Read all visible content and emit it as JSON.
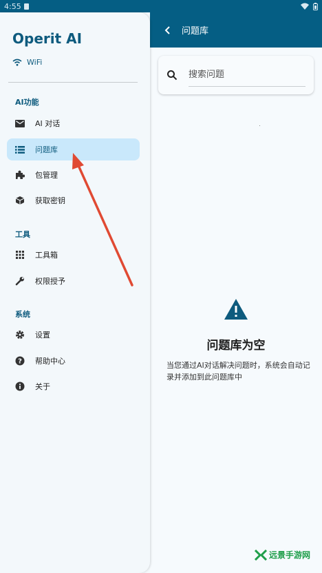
{
  "status_bar": {
    "time": "4:55"
  },
  "app": {
    "name": "Operit AI",
    "network": "WiFi"
  },
  "sections": {
    "ai": "AI功能",
    "tools": "工具",
    "system": "系统"
  },
  "nav": {
    "ai_chat": "AI 对话",
    "question_bank": "问题库",
    "package_manager": "包管理",
    "get_key": "获取密钥",
    "toolbox": "工具箱",
    "permissions": "权限授予",
    "settings": "设置",
    "help": "帮助中心",
    "about": "关于"
  },
  "topbar": {
    "title": "问题库"
  },
  "search": {
    "placeholder": "搜索问题"
  },
  "empty_state": {
    "title": "问题库为空",
    "description": "当您通过AI对话解决问题时，系统会自动记录并添加到此问题库中"
  },
  "watermark": {
    "text": "远景手游网"
  },
  "colors": {
    "primary": "#055e84",
    "active_bg": "#c9e8fb",
    "arrow": "#e04a33",
    "watermark": "#1f9e4a"
  }
}
